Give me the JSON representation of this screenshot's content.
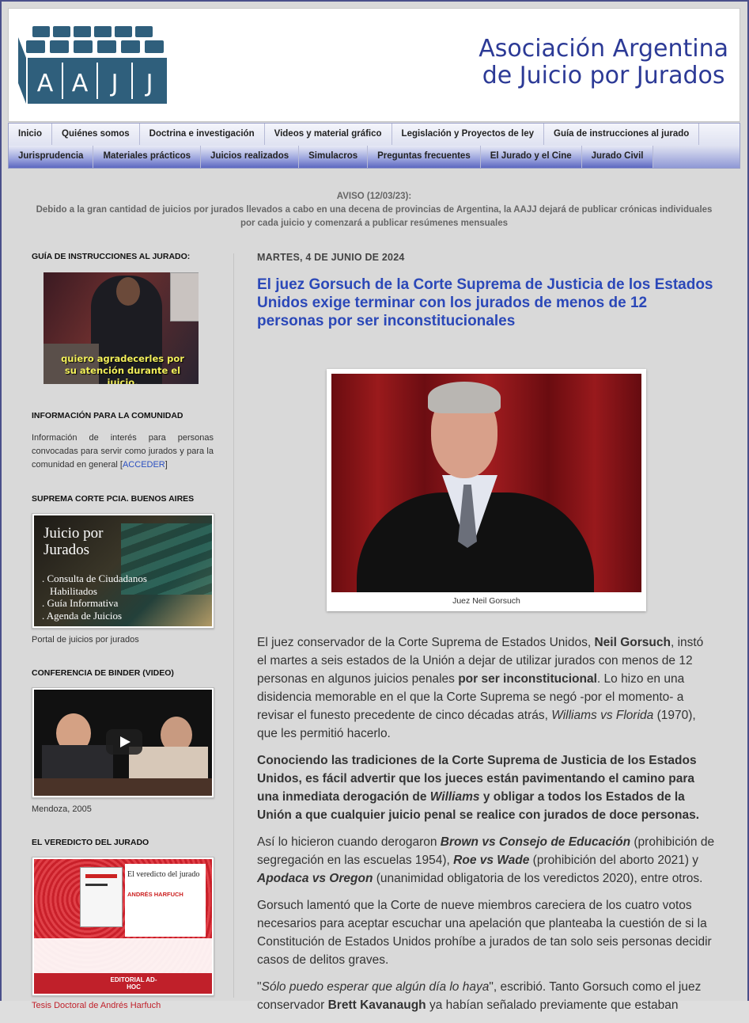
{
  "header": {
    "logo_letters": [
      "A",
      "A",
      "J",
      "J"
    ],
    "title_line1": "Asociación Argentina",
    "title_line2": "de Juicio por Jurados"
  },
  "nav": {
    "row1": [
      "Inicio",
      "Quiénes somos",
      "Doctrina e investigación",
      "Videos y material gráfico",
      "Legislación y Proyectos de ley",
      "Guía de instrucciones al jurado"
    ],
    "row2": [
      "Jurisprudencia",
      "Materiales prácticos",
      "Juicios realizados",
      "Simulacros",
      "Preguntas frecuentes",
      "El Jurado y el Cine",
      "Jurado Civil"
    ]
  },
  "notice": {
    "title": "AVISO (12/03/23):",
    "text": "Debido a la gran cantidad de juicios por jurados llevados a cabo en una decena de provincias de Argentina, la AAJJ dejará de publicar crónicas individuales por cada juicio y comenzará a publicar resúmenes mensuales"
  },
  "sidebar": {
    "guia_heading": "GUÍA DE INSTRUCCIONES AL JURADO:",
    "guia_subtitle": "quiero agradecerles por su atención durante el juicio.",
    "info_heading": "INFORMACIÓN PARA LA COMUNIDAD",
    "info_text": "Información de interés para personas convocadas para servir como jurados y para la comunidad en general [",
    "info_link": "ACCEDER",
    "info_close": "]",
    "scba_heading": "SUPREMA CORTE PCIA. BUENOS AIRES",
    "scba_banner_title": "Juicio por Jurados",
    "scba_banner_items": [
      ". Consulta de Ciudadanos",
      "Habilitados",
      ". Guía Informativa",
      ". Agenda de Juicios"
    ],
    "scba_caption": "Portal de juicios por jurados",
    "binder_heading": "CONFERENCIA DE BINDER (VIDEO)",
    "binder_caption": "Mendoza, 2005",
    "veredicto_heading": "EL VEREDICTO DEL JURADO",
    "book_title": "El veredicto del jurado",
    "book_author": "ANDRÉS HARFUCH",
    "book_publisher": "EDITORIAL AD-HOC",
    "bottom_link": "Tesis Doctoral de Andrés Harfuch"
  },
  "post": {
    "date": "MARTES, 4 DE JUNIO DE 2024",
    "title": "El juez Gorsuch de la Corte Suprema de Justicia de los Estados Unidos exige terminar con los jurados de menos de 12 personas por ser inconstitucionales",
    "photo_caption": "Juez Neil Gorsuch",
    "p1_a": "El juez conservador de la Corte Suprema de Estados Unidos, ",
    "p1_b": "Neil Gorsuch",
    "p1_c": ", instó el martes a seis estados de la Unión a dejar de utilizar jurados con menos de 12 personas en algunos juicios penales ",
    "p1_d": "por ser inconstitucional",
    "p1_e": ". Lo hizo en una disidencia memorable en el que la Corte Suprema se negó -por el momento-  a revisar el funesto precedente de cinco décadas atrás, ",
    "p1_f": "Williams vs Florida",
    "p1_g": " (1970), que les permitió hacerlo.",
    "p2_a": "Conociendo las tradiciones de la Corte Suprema de Justicia de los Estados Unidos, es fácil advertir que los jueces están pavimentando el camino para una inmediata derogación de ",
    "p2_b": "Williams",
    "p2_c": " y obligar a todos los Estados de la Unión a que cualquier juicio penal se realice con jurados de doce personas.",
    "p3_a": "Así lo hicieron cuando derogaron  ",
    "p3_b": "Brown vs Consejo de Educación",
    "p3_c": " (prohibición de segregación en las escuelas 1954), ",
    "p3_d": "Roe vs Wade",
    "p3_e": " (prohibición del aborto 2021) y ",
    "p3_f": "Apodaca vs Oregon",
    "p3_g": " (unanimidad obligatoria de los veredictos 2020), entre otros.",
    "p4": "Gorsuch lamentó que la Corte de nueve miembros careciera de los cuatro votos necesarios para aceptar escuchar una apelación que planteaba la cuestión de si la Constitución de Estados Unidos prohíbe a jurados de tan solo seis personas decidir casos de delitos graves.",
    "p5_a": "\"",
    "p5_b": "Sólo puedo esperar que algún día lo haya",
    "p5_c": "\", escribió. Tanto Gorsuch como el juez conservador ",
    "p5_d": "Brett Kavanaugh",
    "p5_e": " ya habían señalado previamente que estaban"
  },
  "colors": {
    "title_blue": "#2b48b8",
    "link_blue": "#2a4fc0",
    "brand_navy": "#2c3a96",
    "logo_teal": "#2f5f7c"
  }
}
